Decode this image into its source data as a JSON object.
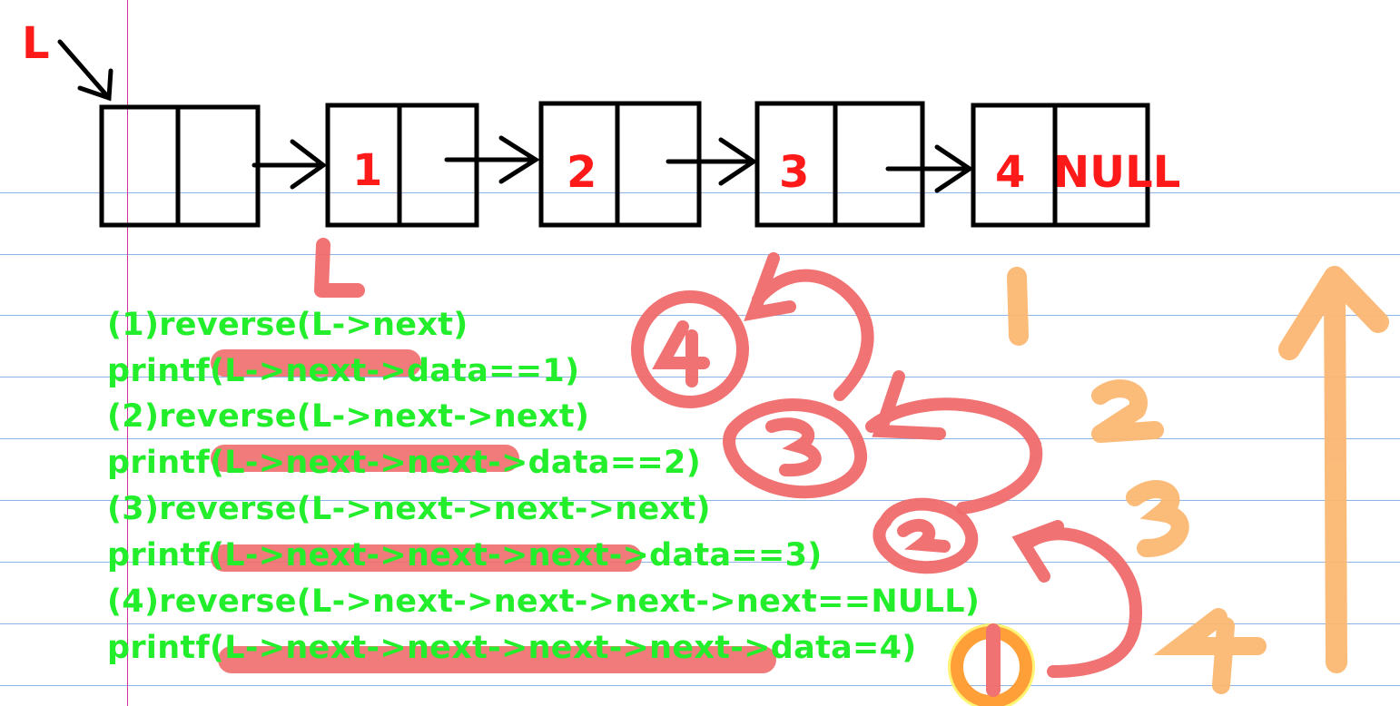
{
  "diagram": {
    "head_pointer_label": "L",
    "nodes": [
      {
        "data": "",
        "next": ""
      },
      {
        "data": "1",
        "next": ""
      },
      {
        "data": "2",
        "next": ""
      },
      {
        "data": "3",
        "next": ""
      },
      {
        "data": "4",
        "next": "NULL"
      }
    ]
  },
  "code_lines": [
    "(1)reverse(L->next)",
    "printf(L->next->data==1)",
    "(2)reverse(L->next->next)",
    "printf(L->next->next->data==2)",
    "(3)reverse(L->next->next->next)",
    "printf(L->next->next->next->data==3)",
    "(4)reverse(L->next->next->next->next==NULL)",
    "printf(L->next->next->next->next->data=4)"
  ],
  "annotations": {
    "handwritten_L": "L",
    "circled_order": [
      "4",
      "3",
      "2",
      "1"
    ],
    "return_order": [
      "1",
      "2",
      "3",
      "4"
    ]
  },
  "colors": {
    "code_green": "#22ee2b",
    "red_ink": "#ff1a1a",
    "pink_marker": "#f06b6b",
    "orange_marker": "#fbb772",
    "ruled_line": "#8fb4e6",
    "margin_line": "#d0309a"
  }
}
